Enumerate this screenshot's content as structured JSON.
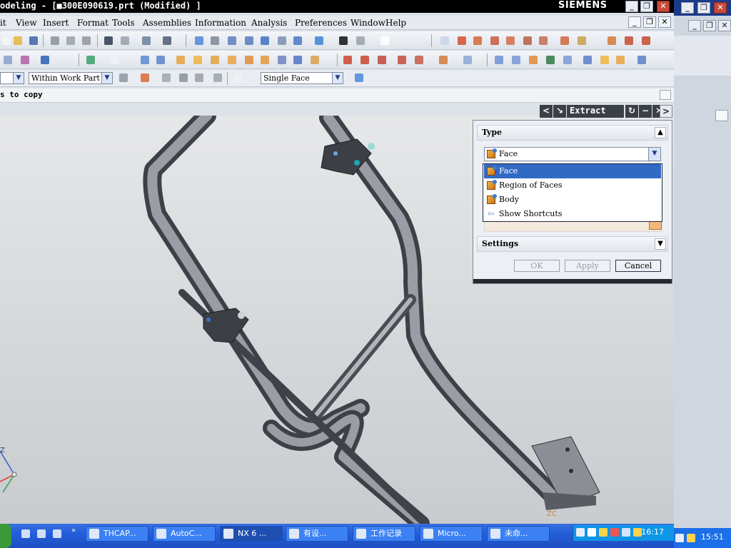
{
  "window": {
    "title": "odeling - [■300E090619.prt (Modified) ]",
    "brand": "SIEMENS",
    "controls": [
      "_",
      "❐",
      "✕"
    ]
  },
  "menubar": {
    "items": [
      "it",
      "View",
      "Insert",
      "Format",
      "Tools",
      "Assemblies",
      "Information",
      "Analysis",
      "Preferences",
      "Window",
      "Help"
    ]
  },
  "selection_bar": {
    "filter_value": "",
    "scope_value": "Within Work Part",
    "face_rule_value": "Single Face"
  },
  "cue_line": {
    "text": "s to copy"
  },
  "dialog": {
    "title": "Extract",
    "type_group_label": "Type",
    "type_selected": "Face",
    "settings_group_label": "Settings",
    "buttons": {
      "ok": "OK",
      "apply": "Apply",
      "cancel": "Cancel"
    }
  },
  "dropdown": {
    "options": [
      "Face",
      "Region of Faces",
      "Body",
      "Show Shortcuts"
    ],
    "selected_index": 0
  },
  "graphics": {
    "csys_labels": {
      "z": "Z",
      "zc": "ZC"
    }
  },
  "taskbar": {
    "items": [
      "THCAP...",
      "AutoC...",
      "NX 6 ...",
      "有设...",
      "工作记录",
      "Micro...",
      "未命..."
    ],
    "active_index": 2,
    "clock": "16:17",
    "clock_outer": "15:51"
  },
  "colors": {
    "dropdown_highlight": "#316ac5",
    "taskbar_blue": "#245edb",
    "dialog_header": "#3b3f46"
  }
}
